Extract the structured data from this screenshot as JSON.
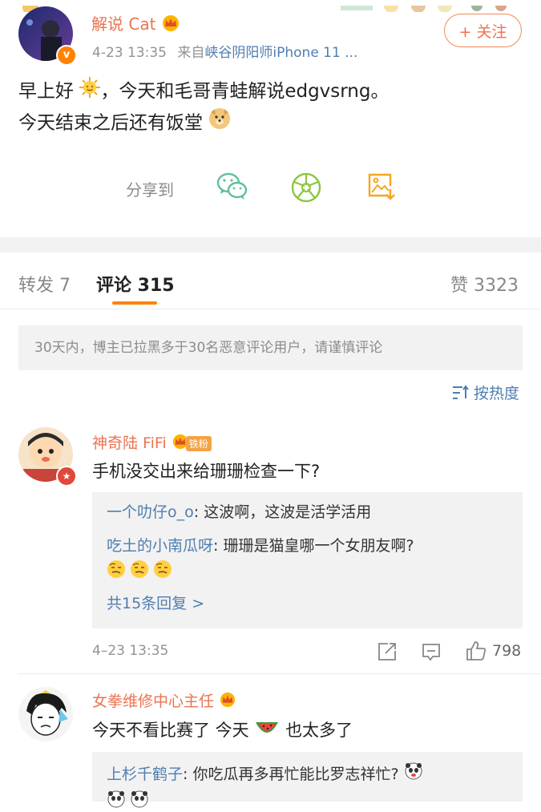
{
  "post": {
    "author": "解说 Cat",
    "time": "4-23 13:35",
    "source_prefix": "来自",
    "source": "峡谷阴阳师iPhone 11 ...",
    "follow_label": "+ 关注",
    "text_line1_part1": "早上好",
    "text_line1_part2": "，今天和毛哥青蛙解说edgvsrng。",
    "text_line2": "今天结束之后还有饭堂",
    "share_label": "分享到",
    "share_icons": [
      "wechat-icon",
      "moments-icon",
      "save-image-icon"
    ]
  },
  "tabs": {
    "repost": "转发 7",
    "comments": "评论 315",
    "likes": "赞 3323"
  },
  "notice": "30天内，博主已拉黑多于30名恶意评论用户，请谨慎评论",
  "sort_label": "按热度",
  "comments": [
    {
      "name": "神奇陆 FiFi",
      "badge": "铁粉",
      "text": "手机没交出来给珊珊检查一下?",
      "replies": [
        {
          "user": "一个叻仔o_o",
          "text": ": 这波啊，这波是活学活用"
        },
        {
          "user": "吃土的小南瓜呀",
          "text": ": 珊珊是猫皇哪一个女朋友啊?"
        }
      ],
      "more": "共15条回复 >",
      "time": "4–23 13:35",
      "likes": "798"
    },
    {
      "name": "女拳维修中心主任",
      "text_part1": "今天不看比赛了 今天",
      "text_part2": "也太多了",
      "replies": [
        {
          "user": "上杉千鹤子",
          "text": ": 你吃瓜再多再忙能比罗志祥忙?"
        }
      ]
    }
  ],
  "colors": {
    "accent_orange": "#eb7350",
    "link_blue": "#507daf",
    "tab_indicator": "#ff8200"
  }
}
